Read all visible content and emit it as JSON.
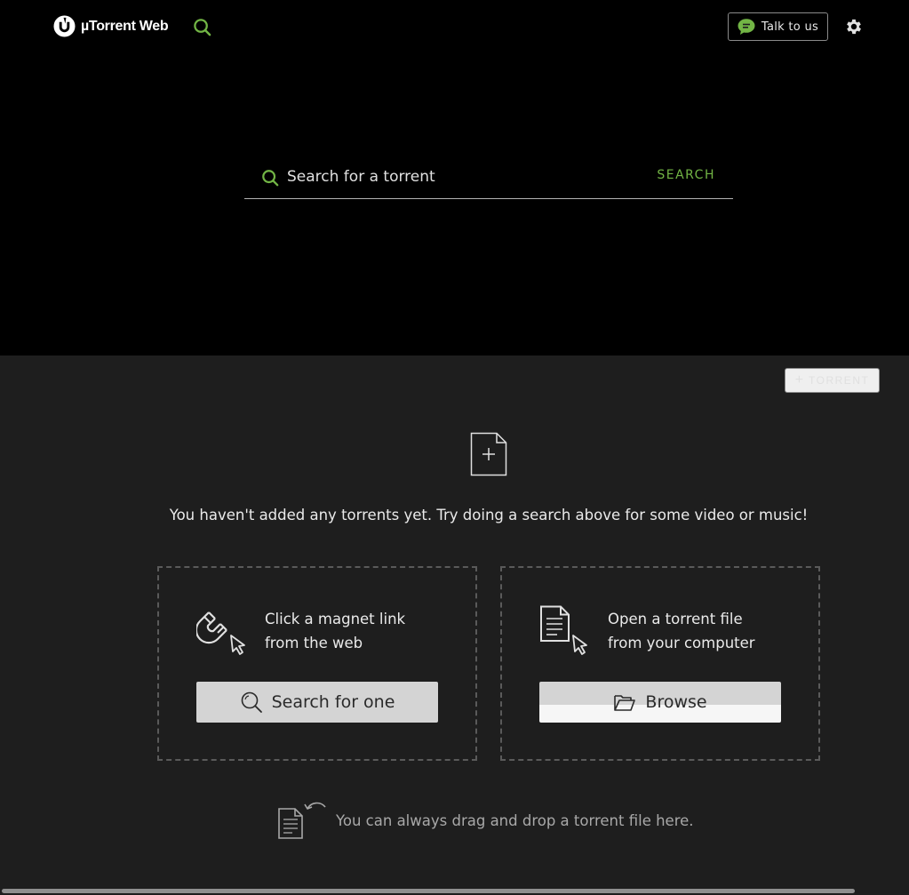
{
  "header": {
    "app_name": "µTorrent Web",
    "talk_label": "Talk to us"
  },
  "search": {
    "placeholder": "Search for a torrent",
    "button_label": "SEARCH"
  },
  "toolbar": {
    "add_torrent_label": "TORRENT"
  },
  "empty_state": {
    "message": "You haven't added any torrents yet. Try doing a search above for some video or music!"
  },
  "magnet_card": {
    "line1": "Click a magnet link",
    "line2": "from the web",
    "button_label": "Search for one"
  },
  "file_card": {
    "line1": "Open a torrent file",
    "line2": "from your computer",
    "button_label": "Browse"
  },
  "drop_hint": "You can always drag and drop a torrent file here.",
  "colors": {
    "accent_green": "#72b545",
    "top_background": "#000000",
    "main_background": "#1e1e1e"
  },
  "icons": [
    "utorrent-logo-icon",
    "search-icon",
    "chat-bubble-icon",
    "gear-icon",
    "plus-icon",
    "new-file-icon",
    "magnet-cursor-icon",
    "document-cursor-icon",
    "magnifier-icon",
    "folder-open-icon",
    "drag-drop-icon"
  ]
}
